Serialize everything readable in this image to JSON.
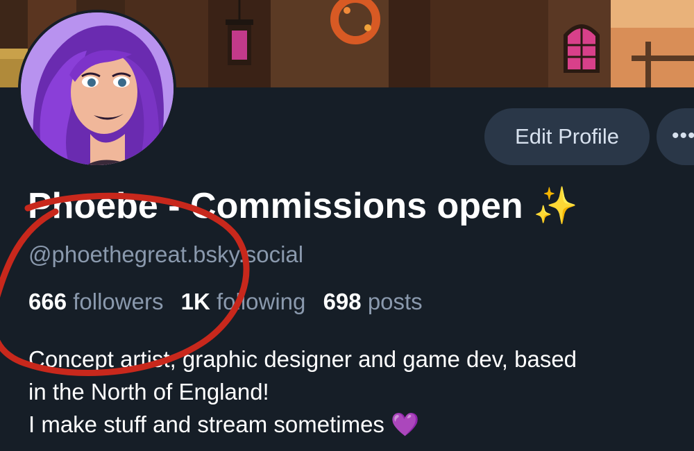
{
  "profile": {
    "display_name": "Phoebe - Commissions open",
    "name_emoji": "✨",
    "handle": "@phoethegreat.bsky.social",
    "followers_count": "666",
    "followers_label": "followers",
    "following_count": "1K",
    "following_label": "following",
    "posts_count": "698",
    "posts_label": "posts",
    "bio_text": "Concept artist, graphic designer and game dev, based\nin the North of England!\nI make stuff and stream sometimes",
    "bio_emoji": "💜"
  },
  "actions": {
    "edit_profile_label": "Edit Profile",
    "more_label": "•••"
  },
  "colors": {
    "background": "#161e27",
    "button_bg": "#2a3748",
    "muted_text": "#8a99ad",
    "annotation_red": "#c8281c"
  }
}
